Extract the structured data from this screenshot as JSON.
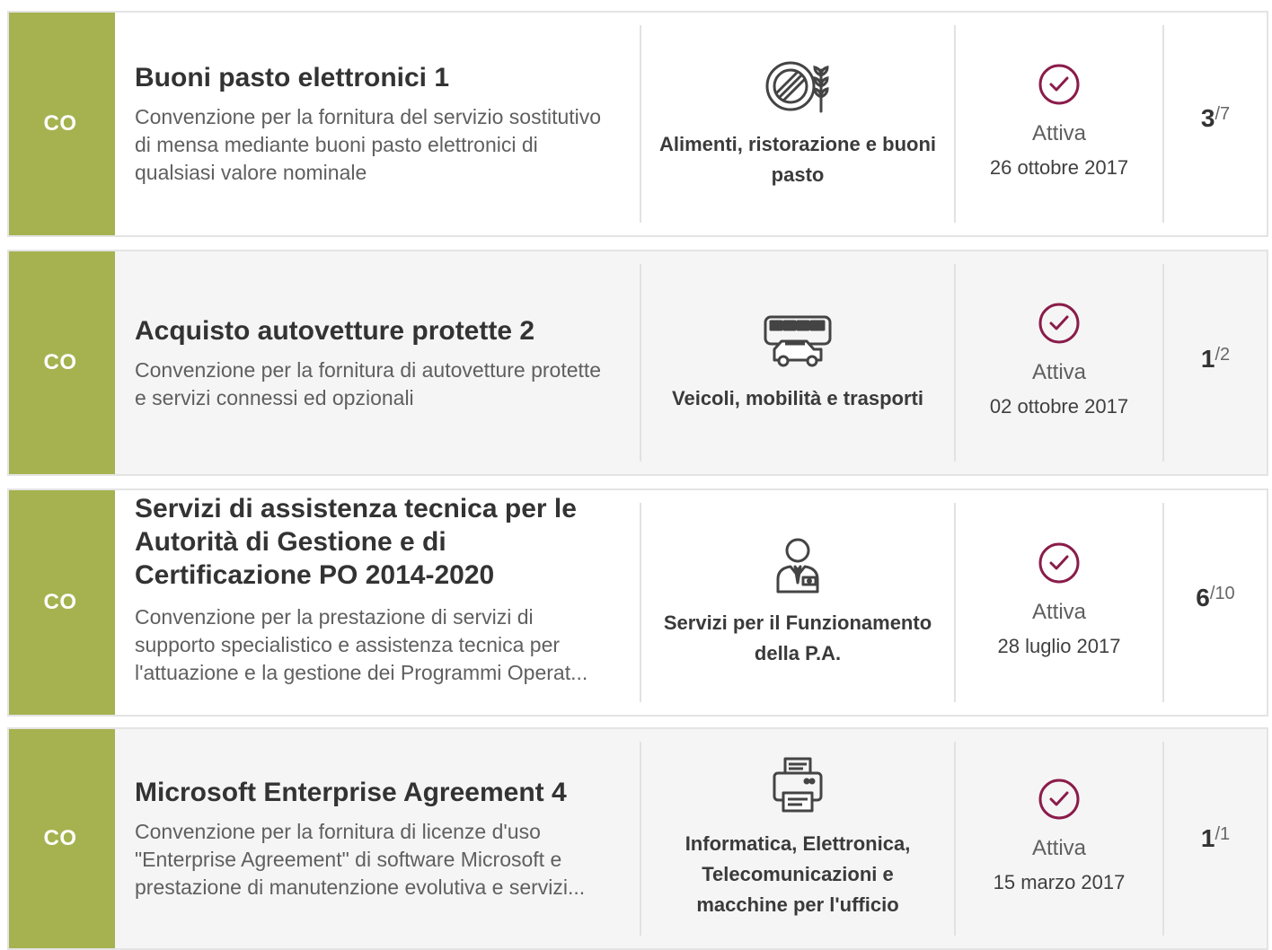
{
  "colors": {
    "badge": "#a6b24f",
    "status_icon": "#8a1c4a"
  },
  "rows": [
    {
      "badge": "CO",
      "title": "Buoni pasto elettronici 1",
      "description": "Convenzione per la fornitura del servizio sostitutivo di mensa mediante buoni pasto elettronici di qualsiasi valore nominale",
      "category": {
        "icon": "food-icon",
        "label": "Alimenti, ristorazione e buoni pasto"
      },
      "status": {
        "icon": "check-circle-icon",
        "text": "Attiva",
        "date": "26 ottobre 2017"
      },
      "count": {
        "current": "3",
        "separator": "/",
        "total": "7"
      }
    },
    {
      "badge": "CO",
      "title": "Acquisto autovetture protette 2",
      "description": "Convenzione per la fornitura di autovetture protette e servizi connessi ed opzionali",
      "category": {
        "icon": "vehicles-icon",
        "label": "Veicoli, mobilità e trasporti"
      },
      "status": {
        "icon": "check-circle-icon",
        "text": "Attiva",
        "date": "02 ottobre 2017"
      },
      "count": {
        "current": "1",
        "separator": "/",
        "total": "2"
      }
    },
    {
      "badge": "CO",
      "title": "Servizi di assistenza tecnica per le Autorità di Gestione e di Certificazione PO 2014-2020",
      "description": "Convenzione per la prestazione di servizi di supporto specialistico e assistenza tecnica per l'attuazione e la gestione dei Programmi Operat...",
      "category": {
        "icon": "public-servant-icon",
        "label": "Servizi per il Funzionamento della P.A."
      },
      "status": {
        "icon": "check-circle-icon",
        "text": "Attiva",
        "date": "28 luglio 2017"
      },
      "count": {
        "current": "6",
        "separator": "/",
        "total": "10"
      }
    },
    {
      "badge": "CO",
      "title": "Microsoft Enterprise Agreement 4",
      "description": "Convenzione per la fornitura di licenze d'uso \"Enterprise Agreement\" di software Microsoft e prestazione di manutenzione evolutiva e servizi...",
      "category": {
        "icon": "printer-icon",
        "label": "Informatica, Elettronica, Telecomunicazioni e macchine per l'ufficio"
      },
      "status": {
        "icon": "check-circle-icon",
        "text": "Attiva",
        "date": "15 marzo 2017"
      },
      "count": {
        "current": "1",
        "separator": "/",
        "total": "1"
      }
    }
  ]
}
